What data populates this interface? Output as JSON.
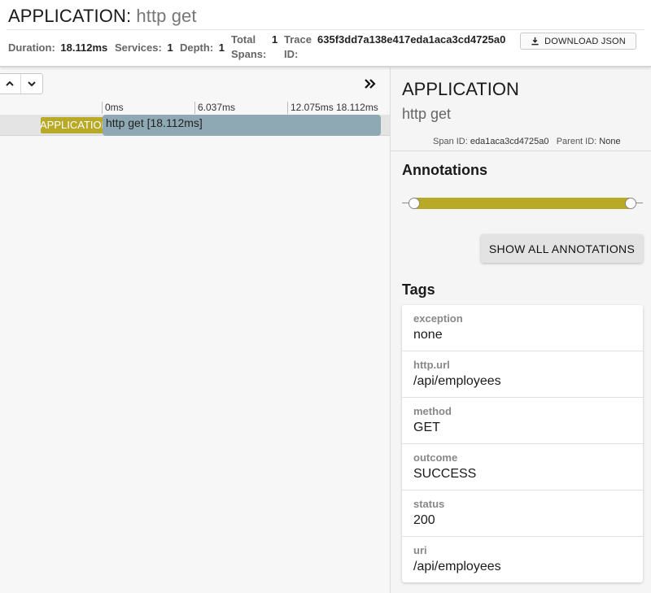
{
  "header": {
    "service_name": "APPLICATION",
    "separator": ":",
    "span_name": "http get",
    "duration_label": "Duration:",
    "duration_value": "18.112ms",
    "services_label": "Services:",
    "services_value": "1",
    "depth_label": "Depth:",
    "depth_value": "1",
    "total_spans_label_1": "Total",
    "total_spans_label_2": "Spans:",
    "total_spans_value": "1",
    "trace_id_label_1": "Trace",
    "trace_id_label_2": "ID:",
    "trace_id_value": "635f3dd7a138e417eda1aca3cd4725a0",
    "download_label": "DOWNLOAD JSON"
  },
  "timeline": {
    "ticks": [
      "0ms",
      "6.037ms",
      "12.075ms",
      "18.112ms"
    ],
    "span": {
      "service": "APPLICATION",
      "label": "http get [18.112ms]"
    }
  },
  "detail": {
    "service_name": "APPLICATION",
    "span_name": "http get",
    "span_id_label": "Span ID:",
    "span_id_value": "eda1aca3cd4725a0",
    "parent_id_label": "Parent ID:",
    "parent_id_value": "None",
    "annotations_title": "Annotations",
    "show_annotations_label": "SHOW ALL ANNOTATIONS",
    "tags_title": "Tags",
    "tags": [
      {
        "key": "exception",
        "value": "none"
      },
      {
        "key": "http.url",
        "value": "/api/employees"
      },
      {
        "key": "method",
        "value": "GET"
      },
      {
        "key": "outcome",
        "value": "SUCCESS"
      },
      {
        "key": "status",
        "value": "200"
      },
      {
        "key": "uri",
        "value": "/api/employees"
      }
    ]
  },
  "colors": {
    "service_accent": "#b8a927",
    "span_bar": "#8ea9b3"
  },
  "icons": [
    "download-icon",
    "chevron-up-icon",
    "chevron-down-icon",
    "double-chevron-right-icon"
  ]
}
